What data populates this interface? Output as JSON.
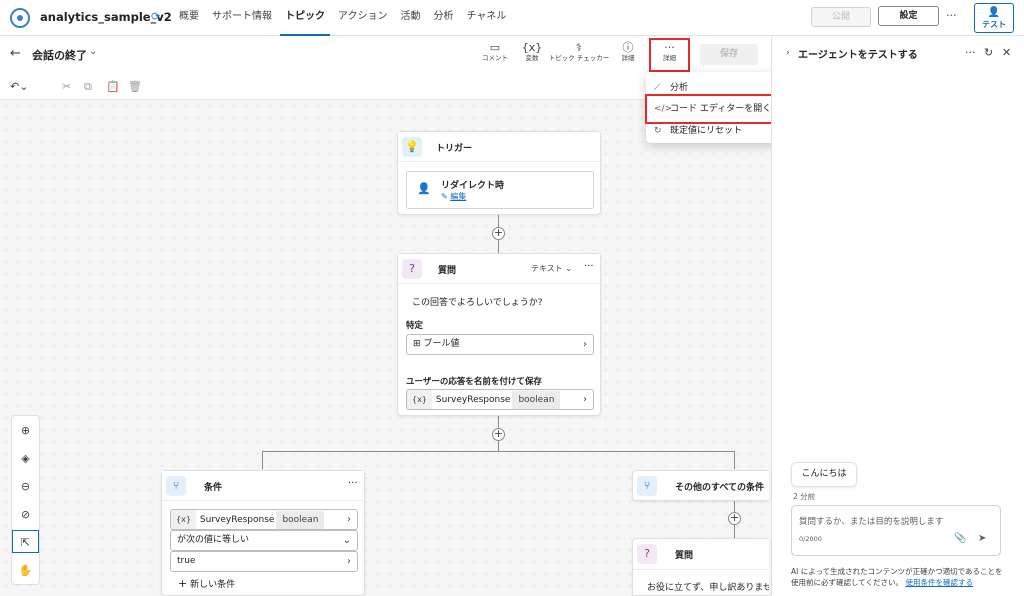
{
  "app": {
    "name": "analytics_sample_v2"
  },
  "nav": [
    "概要",
    "サポート情報",
    "トピック",
    "アクション",
    "活動",
    "分析",
    "チャネル"
  ],
  "nav_active": "トピック",
  "header_actions": {
    "publish": "公開",
    "settings": "設定",
    "more": "···",
    "test": "テスト"
  },
  "topic": {
    "title": "会話の終了"
  },
  "toolbar": {
    "comment": "コメント",
    "variables": "変数",
    "topic_checker": "トピック チェッカー",
    "details": "詳細",
    "more": "詳細",
    "save": "保存"
  },
  "menu": {
    "analytics": "分析",
    "open_code_editor": "コード エディターを開く",
    "reset": "既定値にリセット"
  },
  "trigger_node": {
    "title": "トリガー",
    "label": "リダイレクト時",
    "edit": "編集"
  },
  "question_node": {
    "title": "質問",
    "type": "テキスト",
    "prompt": "この回答でよろしいでしょうか?",
    "identify_label": "特定",
    "identify_value": "ブール値",
    "save_label": "ユーザーの応答を名前を付けて保存",
    "var_name": "SurveyResponse",
    "var_type": "boolean"
  },
  "condition_node": {
    "title": "条件",
    "var_name": "SurveyResponse",
    "var_type": "boolean",
    "operator": "が次の値に等しい",
    "value": "true",
    "new_condition": "新しい条件"
  },
  "other_node": {
    "title": "その他のすべての条件"
  },
  "question_node2": {
    "title": "質問",
    "text": "お役に立てず、申し訳ありませ"
  },
  "test_panel": {
    "title": "エージェントをテストする",
    "greeting": "こんにちは",
    "time": "2 分前",
    "placeholder": "質問するか、または目的を説明します",
    "counter": "0/2000",
    "disclaimer": "AI によって生成されたコンテンツが正確かつ適切であることを使用前に必ず確認してください。",
    "terms_link": "使用条件を確認する"
  },
  "colors": {
    "accent": "#0f6cbd",
    "highlight": "#e32b2b",
    "trigger_badge": "#e3f0fb",
    "question_badge": "#f3e8f5"
  }
}
